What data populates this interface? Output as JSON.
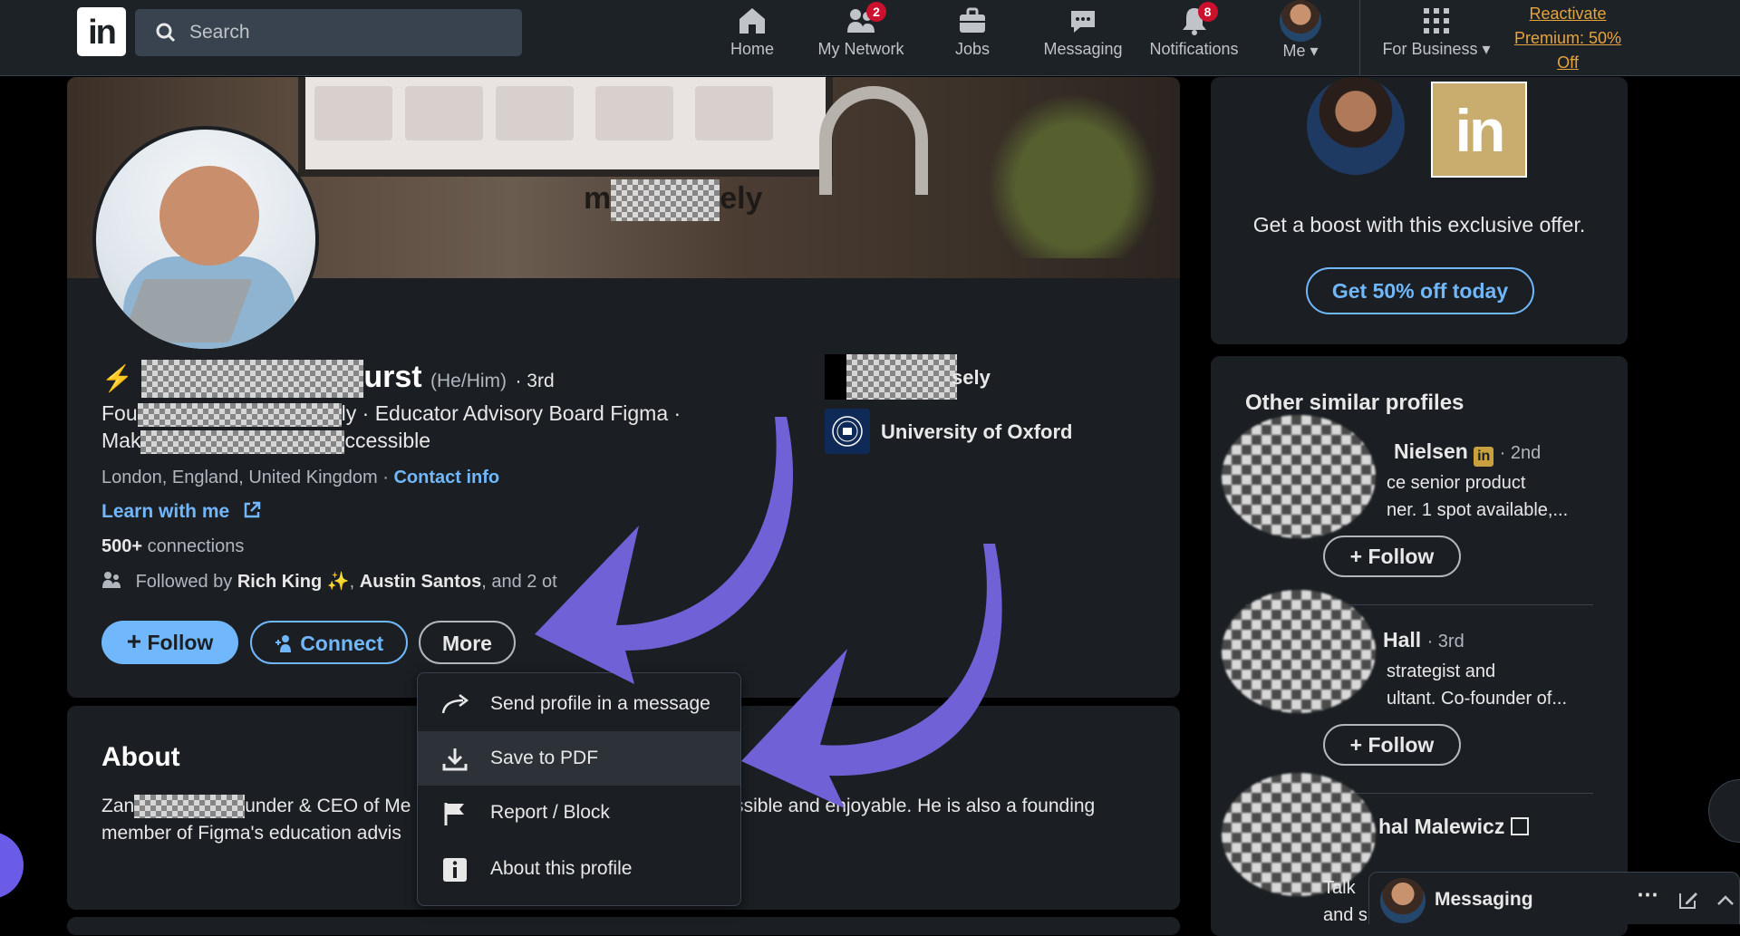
{
  "nav": {
    "search_placeholder": "Search",
    "home": "Home",
    "network": "My Network",
    "network_badge": "2",
    "jobs": "Jobs",
    "messaging": "Messaging",
    "notifications": "Notifications",
    "notifications_badge": "8",
    "me": "Me",
    "for_business": "For Business",
    "premium_line1": "Reactivate",
    "premium_line2": "Premium: 50%",
    "premium_line3": "Off"
  },
  "profile": {
    "banner_text_left": "m",
    "banner_text_right": "ely",
    "name_suffix": "urst",
    "pronouns": "(He/Him)",
    "degree": "· 3rd",
    "headline_line1_start": "Fou",
    "headline_line1_end": "ly · Educator Advisory Board Figma ·",
    "headline_line2_start": "Mak",
    "headline_line2_end": "ccessible",
    "location": "London, England, United Kingdom ·",
    "contact_info": "Contact info",
    "learn_with_me": "Learn with me",
    "connections_count": "500+",
    "connections_label": "connections",
    "followed_prefix": "Followed by",
    "followed_name1": "Rich King",
    "followed_sparkle": "✨,",
    "followed_name2": "Austin Santos",
    "followed_suffix": ", and 2 ot",
    "follow_btn": "Follow",
    "connect_btn": "Connect",
    "more_btn": "More",
    "company_suffix": "sely",
    "school": "University of Oxford"
  },
  "about": {
    "title": "About",
    "line1_start": "Zan",
    "line1_mid": "under & CEO of Me",
    "line1_end": "essible and enjoyable. He is also a founding",
    "line2": "member of Figma's education advis"
  },
  "dropdown": {
    "items": [
      {
        "label": "Send profile in a message",
        "icon": "share-arrow-icon"
      },
      {
        "label": "Save to PDF",
        "icon": "download-icon"
      },
      {
        "label": "Report / Block",
        "icon": "flag-icon"
      },
      {
        "label": "About this profile",
        "icon": "info-icon"
      }
    ]
  },
  "sidebar": {
    "offer_text": "Get a boost with this exclusive offer.",
    "offer_btn": "Get 50% off today",
    "similar_title": "Other similar profiles",
    "profiles": [
      {
        "name": "Nielsen",
        "degree": "· 2nd",
        "desc1": "ce senior product",
        "desc2": "ner. 1 spot available,...",
        "follow": "Follow"
      },
      {
        "name": "Hall",
        "degree": "· 3rd",
        "desc1": "strategist and",
        "desc2": "ultant. Co-founder of...",
        "follow": "Follow"
      },
      {
        "name": "hal Malewicz",
        "degree": "",
        "desc1": "Talk",
        "desc2": "and s",
        "follow": ""
      }
    ]
  },
  "messaging_bar": {
    "label": "Messaging"
  },
  "colors": {
    "accent": "#71b7fb",
    "arrow": "#7061d6",
    "premium": "#e7a33e"
  }
}
